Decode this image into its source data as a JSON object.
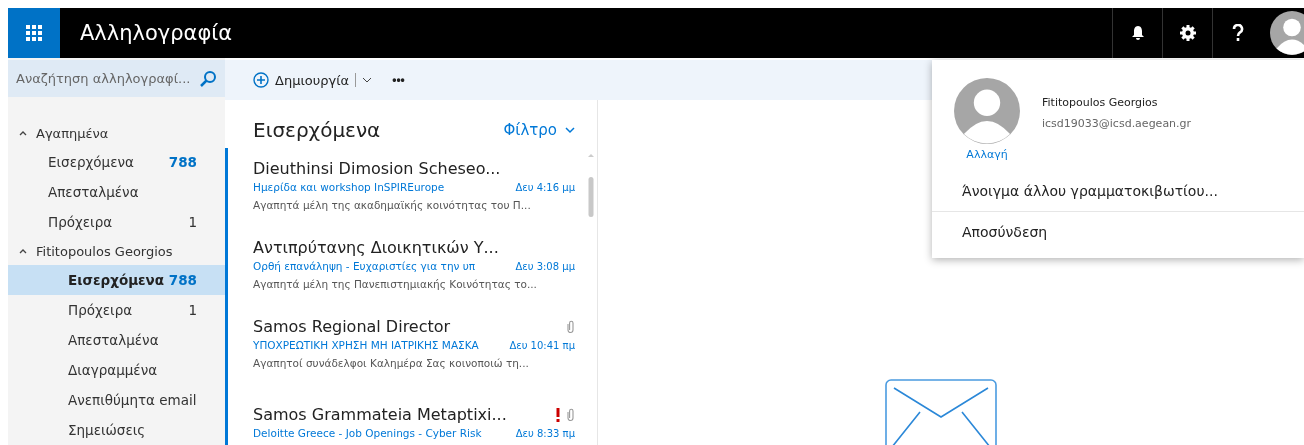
{
  "app_bar": {
    "title": "Αλληλογραφία"
  },
  "search": {
    "placeholder": "Αναζήτηση αλληλογραφί..."
  },
  "toolbar": {
    "new_button": "Δημιουργία",
    "more": "•••"
  },
  "folders": [
    {
      "label": "Αγαπημένα",
      "expanded": true,
      "children": [
        {
          "label": "Εισερχόμενα",
          "count": "788",
          "selected": false
        },
        {
          "label": "Απεσταλμένα",
          "selected": false
        },
        {
          "label": "Πρόχειρα",
          "count": "1",
          "selected": false
        }
      ]
    },
    {
      "label": "Fititopoulos Georgios",
      "expanded": true,
      "children": [
        {
          "label": "Εισερχόμενα",
          "count": "788",
          "selected": true
        },
        {
          "label": "Πρόχειρα",
          "count": "1",
          "selected": false
        },
        {
          "label": "Απεσταλμένα",
          "selected": false
        },
        {
          "label": "Διαγραμμένα",
          "selected": false
        },
        {
          "label": "Ανεπιθύμητα email",
          "selected": false
        },
        {
          "label": "Σημειώσεις",
          "selected": false
        }
      ]
    }
  ],
  "message_list": {
    "title": "Εισερχόμενα",
    "filter": "Φίλτρο",
    "messages": [
      {
        "sender": "Dieuthinsi Dimosion Scheseo...",
        "subject": "Ημερίδα και workshop InSPIREurope",
        "time": "Δευ 4:16 μμ",
        "preview": "Αγαπητά μέλη της ακαδημαϊκής κοινότητας του Π...",
        "unread": true,
        "important": false,
        "attachment": false
      },
      {
        "sender": "Αντιπρύτανης Διοικητικών Υ...",
        "subject": "Ορθή επανάληψη - Ευχαριστίες για την υπ",
        "time": "Δευ 3:08 μμ",
        "preview": "Αγαπητά μέλη της Πανεπιστημιακής Κοινότητας το...",
        "unread": true,
        "important": false,
        "attachment": false
      },
      {
        "sender": "Samos Regional Director",
        "subject": "ΥΠΟΧΡΕΩΤΙΚΗ ΧΡΗΣΗ ΜΗ ΙΑΤΡΙΚΗΣ ΜΑΣΚΑ",
        "time": "Δευ 10:41 πμ",
        "preview": "Αγαπητοί συνάδελφοι Καλημέρα Σας κοινοποιώ τη...",
        "unread": true,
        "important": false,
        "attachment": true
      },
      {
        "sender": "Samos Grammateia Metaptixi...",
        "subject": "Deloitte Greece - Job Openings - Cyber Risk",
        "time": "Δευ 8:33 πμ",
        "unread": true,
        "important": true,
        "attachment": true
      }
    ]
  },
  "account_menu": {
    "name": "Fititopoulos Georgios",
    "email": "icsd19033@icsd.aegean.gr",
    "change_link": "Αλλαγή",
    "items": [
      "Άνοιγμα άλλου γραμματοκιβωτίου...",
      "Αποσύνδεση"
    ]
  }
}
